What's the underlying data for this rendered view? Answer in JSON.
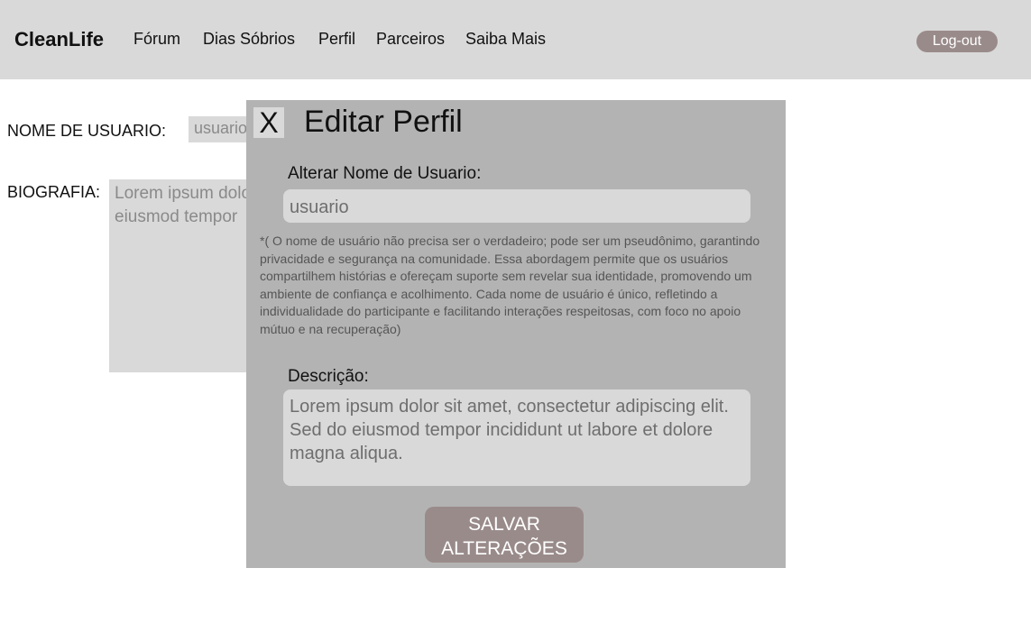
{
  "header": {
    "brand": "CleanLife",
    "nav": [
      "Fórum",
      "Dias Sóbrios",
      "Perfil",
      "Parceiros",
      "Saiba Mais"
    ],
    "logout_label": "Log-out"
  },
  "profile": {
    "username_label": "NOME DE USUARIO:",
    "username_value": "usuario",
    "bio_label": "BIOGRAFIA:",
    "bio_text": "Lorem ipsum dolor sit amet,\neiusmod tempor"
  },
  "modal": {
    "close_label": "X",
    "title": "Editar Perfil",
    "username_label": "Alterar Nome de Usuario:",
    "username_value": "usuario",
    "note": "*( O nome de usuário não precisa ser o verdadeiro; pode ser um pseudônimo, garantindo privacidade e segurança na comunidade. Essa abordagem permite que os usuários compartilhem histórias e ofereçam suporte sem revelar sua identidade, promovendo um ambiente de confiança e acolhimento. Cada nome de usuário é único, refletindo a individualidade do participante e facilitando interações respeitosas, com foco no apoio mútuo e na recuperação)",
    "description_label": "Descrição:",
    "description_value": "Lorem ipsum dolor sit amet, consectetur adipiscing elit. Sed do eiusmod tempor incididunt ut labore et dolore magna aliqua.",
    "save_label": "SALVAR ALTERAÇÕES"
  }
}
